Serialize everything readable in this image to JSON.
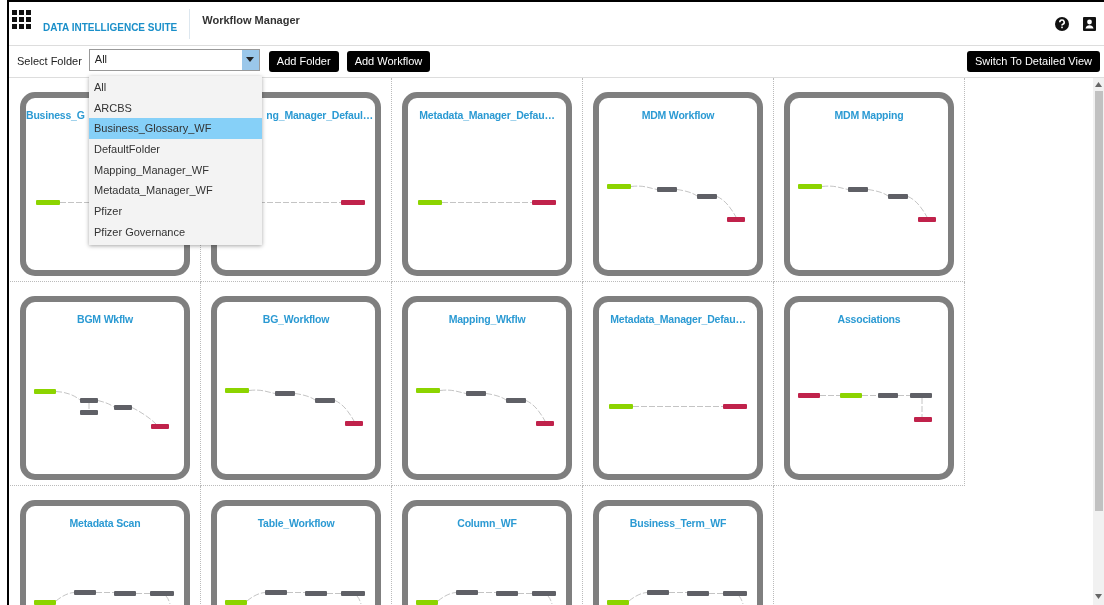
{
  "header": {
    "brand": "DATA INTELLIGENCE SUITE",
    "title": "Workflow Manager"
  },
  "toolbar": {
    "folder_label": "Select Folder",
    "folder_value": "All",
    "buttons": [
      "Add Folder",
      "Add Workflow"
    ],
    "view_button": "Switch To Detailed View"
  },
  "folder_dropdown": {
    "expanded": true,
    "options": [
      {
        "label": "All",
        "selected": false
      },
      {
        "label": "ARCBS",
        "selected": false
      },
      {
        "label": "Business_Glossary_WF",
        "selected": true
      },
      {
        "label": "DefaultFolder",
        "selected": false
      },
      {
        "label": "Mapping_Manager_WF",
        "selected": false
      },
      {
        "label": "Metadata_Manager_WF",
        "selected": false
      },
      {
        "label": "Pfizer",
        "selected": false
      },
      {
        "label": "Pfizer Governance",
        "selected": false
      }
    ]
  },
  "workflows": [
    {
      "title": "Business_G",
      "covered_right": true,
      "kind": "direct"
    },
    {
      "title": "ng_Manager_Defaul…",
      "covered_left": true,
      "kind": "direct"
    },
    {
      "title": "Metadata_Manager_Defau…",
      "kind": "direct"
    },
    {
      "title": "MDM Workflow",
      "kind": "curve"
    },
    {
      "title": "MDM Mapping",
      "kind": "curve"
    },
    {
      "title": "BGM Wkflw",
      "kind": "branch"
    },
    {
      "title": "BG_Workflow",
      "kind": "curve"
    },
    {
      "title": "Mapping_Wkflw",
      "kind": "curve"
    },
    {
      "title": "Metadata_Manager_Defau…",
      "kind": "direct"
    },
    {
      "title": "Associations",
      "kind": "fork"
    },
    {
      "title": "Metadata Scan",
      "kind": "row"
    },
    {
      "title": "Table_Workflow",
      "kind": "row"
    },
    {
      "title": "Column_WF",
      "kind": "row"
    },
    {
      "title": "Business_Term_WF",
      "kind": "row"
    }
  ]
}
